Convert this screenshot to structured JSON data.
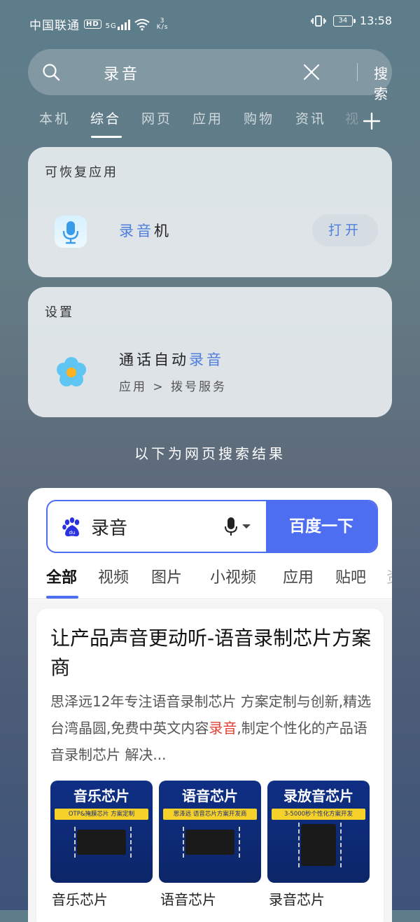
{
  "status_bar": {
    "carrier": "中国联通",
    "hd": "HD",
    "network": "5G",
    "speed_value": "3",
    "speed_unit": "K/s",
    "battery": "34",
    "time": "13:58"
  },
  "search": {
    "query": "录音",
    "button_label": "搜索"
  },
  "tabs": [
    {
      "label": "本机",
      "active": false
    },
    {
      "label": "综合",
      "active": true
    },
    {
      "label": "网页",
      "active": false
    },
    {
      "label": "应用",
      "active": false
    },
    {
      "label": "购物",
      "active": false
    },
    {
      "label": "资讯",
      "active": false
    },
    {
      "label": "视",
      "active": false
    }
  ],
  "recoverable_apps": {
    "title": "可恢复应用",
    "app_name_highlight": "录音",
    "app_name_rest": "机",
    "open_label": "打开"
  },
  "settings": {
    "title": "设置",
    "item_prefix": "通话自动",
    "item_highlight": "录音",
    "path": "应用 > 拨号服务"
  },
  "web_results_label": "以下为网页搜索结果",
  "baidu": {
    "query": "录音",
    "search_button": "百度一下",
    "tabs": [
      "全部",
      "视频",
      "图片",
      "小视频",
      "应用",
      "贴吧",
      "资"
    ],
    "result": {
      "title": "让产品声音更动听-语音录制芯片方案商",
      "desc_before": "思泽远12年专注语音录制芯片 方案定制与创新,精选台湾晶圆,免费中英文内容",
      "desc_highlight": "录音",
      "desc_after": ",制定个性化的产品语音录制芯片 解决...",
      "thumbnails": [
        {
          "title": "音乐芯片",
          "subtitle": "OTP&掩膜芯片 方案定制",
          "label": "音乐芯片"
        },
        {
          "title": "语音芯片",
          "subtitle": "思泽远 语音芯片方案开发商",
          "label": "语音芯片"
        },
        {
          "title": "录放音芯片",
          "subtitle": "3-5000秒个性化方案开发",
          "label": "录音芯片"
        }
      ]
    }
  },
  "colors": {
    "accent_blue": "#4e6ef2",
    "highlight_blue": "#4f7fdd",
    "highlight_red": "#e33e33"
  }
}
